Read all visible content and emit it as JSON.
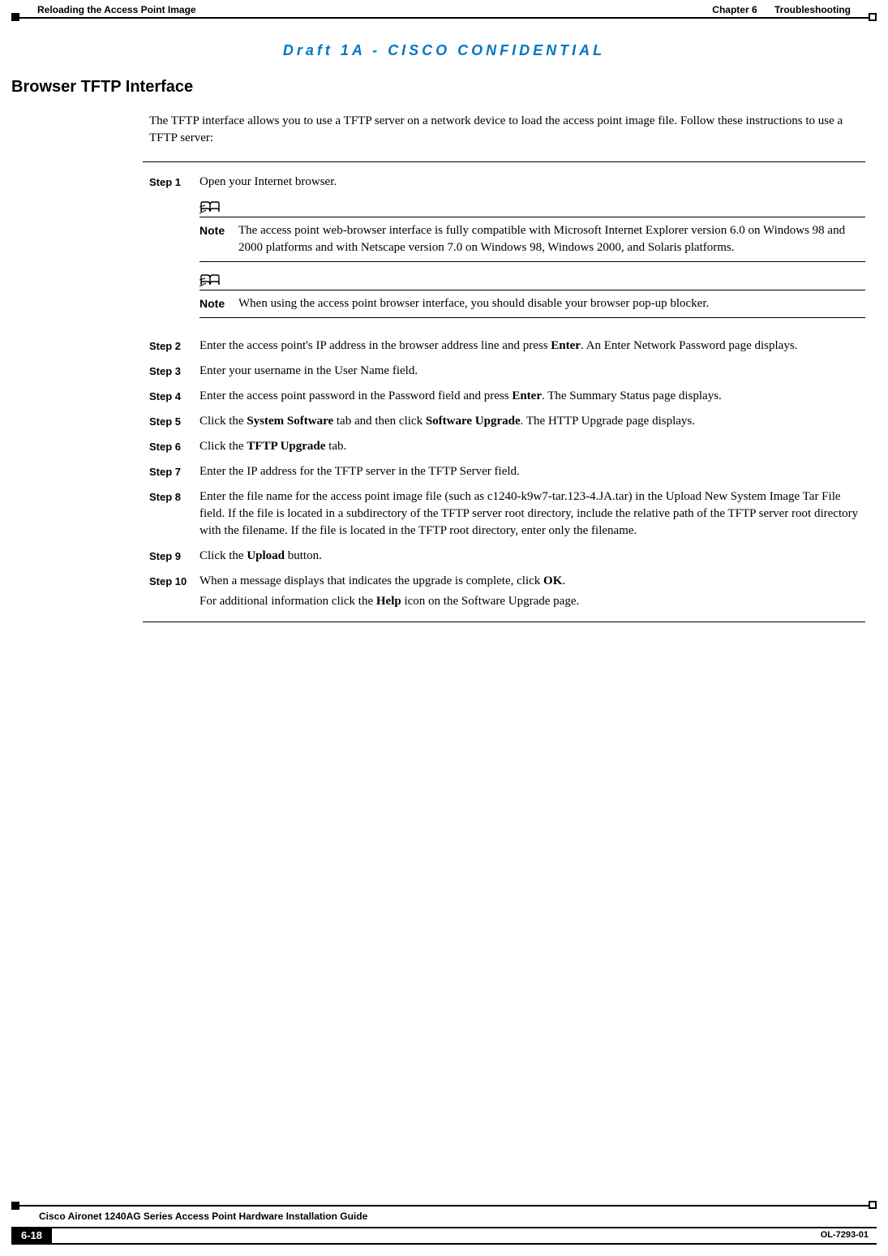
{
  "header": {
    "left_section": "Reloading the Access Point Image",
    "chapter_label": "Chapter 6",
    "chapter_title": "Troubleshooting"
  },
  "confidential": "Draft 1A - CISCO CONFIDENTIAL",
  "section_title": "Browser TFTP Interface",
  "intro": "The TFTP interface allows you to use a TFTP server on a network device to load the access point image file. Follow these instructions to use a TFTP server:",
  "steps": {
    "s1": {
      "label": "Step 1",
      "text": "Open your Internet browser."
    },
    "s2": {
      "label": "Step 2",
      "text_a": "Enter the access point's IP address in the browser address line and press ",
      "b1": "Enter",
      "text_b": ". An Enter Network Password page displays."
    },
    "s3": {
      "label": "Step 3",
      "text": "Enter your username in the User Name field."
    },
    "s4": {
      "label": "Step 4",
      "text_a": "Enter the access point password in the Password field and press ",
      "b1": "Enter",
      "text_b": ". The Summary Status page displays."
    },
    "s5": {
      "label": "Step 5",
      "text_a": "Click the ",
      "b1": "System Software",
      "text_b": " tab and then click ",
      "b2": "Software Upgrade",
      "text_c": ". The HTTP Upgrade page displays."
    },
    "s6": {
      "label": "Step 6",
      "text_a": "Click the ",
      "b1": "TFTP Upgrade",
      "text_b": " tab."
    },
    "s7": {
      "label": "Step 7",
      "text": "Enter the IP address for the TFTP server in the TFTP Server field."
    },
    "s8": {
      "label": "Step 8",
      "text": "Enter the file name for the access point image file (such as c1240-k9w7-tar.123-4.JA.tar) in the Upload New System Image Tar File field. If the file is located in a subdirectory of the TFTP server root directory, include the relative path of the TFTP server root directory with the filename. If the file is located in the TFTP root directory, enter only the filename."
    },
    "s9": {
      "label": "Step 9",
      "text_a": "Click the ",
      "b1": "Upload",
      "text_b": " button."
    },
    "s10": {
      "label": "Step 10",
      "text_a": "When a message displays that indicates the upgrade is complete, click ",
      "b1": "OK",
      "text_b": ".",
      "post_a": "For additional information click the ",
      "post_b1": "Help",
      "post_b": " icon on the Software Upgrade page."
    }
  },
  "notes": {
    "note_label": "Note",
    "n1": "The access point web-browser interface is fully compatible with Microsoft Internet Explorer version 6.0 on Windows 98 and 2000 platforms and with Netscape version 7.0 on Windows 98, Windows 2000, and Solaris platforms.",
    "n2": "When using the access point browser interface, you should disable your browser pop-up blocker."
  },
  "footer": {
    "guide_title": "Cisco Aironet 1240AG Series Access Point Hardware Installation Guide",
    "page_number": "6-18",
    "doc_number": "OL-7293-01"
  }
}
